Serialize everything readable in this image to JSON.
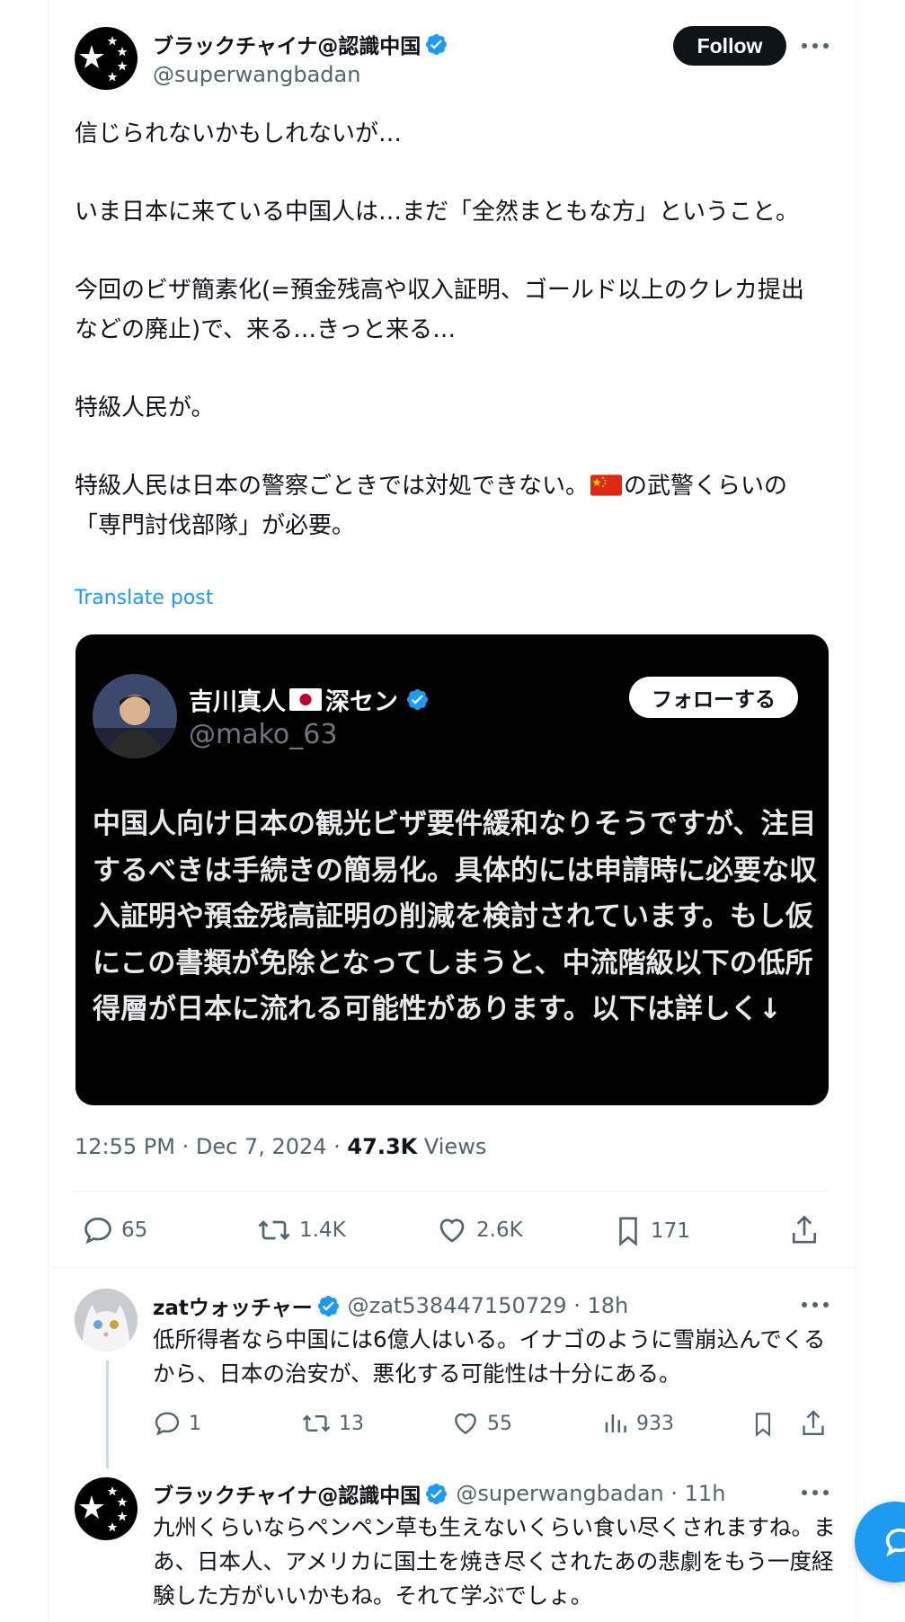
{
  "post": {
    "author_name": "ブラックチャイナ@認識中国",
    "author_handle": "@superwangbadan",
    "follow_label": "Follow",
    "text": {
      "p1": "信じられないかもしれないが…",
      "p2": "いま日本に来ている中国人は…まだ「全然まともな方」ということ。",
      "p3": "今回のビザ簡素化(=預金残高や収入証明、ゴールド以上のクレカ提出などの廃止)で、来る…きっと来る…",
      "p4": "特級人民が。",
      "p5a": "特級人民は日本の警察ごときでは対処できない。",
      "p5b": "の武警くらいの「専門討伐部隊」が必要。"
    },
    "translate_label": "Translate post",
    "timestamp": "12:55 PM · Dec 7, 2024 · ",
    "views_count": "47.3K",
    "views_label": " Views",
    "stats": {
      "replies": "65",
      "reposts": "1.4K",
      "likes": "2.6K",
      "bookmarks": "171"
    }
  },
  "embedded": {
    "name_a": "吉川真人",
    "name_b": "深セン",
    "handle": "@mako_63",
    "follow_label": "フォローする",
    "text": "中国人向け日本の観光ビザ要件緩和なりそうですが、注目するべきは手続きの簡易化。具体的には申請時に必要な収入証明や預金残高証明の削減を検討されています。もし仮にこの書類が免除となってしまうと、中流階級以下の低所得層が日本に流れる可能性があります。以下は詳しく↓"
  },
  "replies": [
    {
      "name": "zatウォッチャー",
      "handle_time": "@zat538447150729 · 18h",
      "text": "低所得者なら中国には6億人はいる。イナゴのように雪崩込んでくるから、日本の治安が、悪化する可能性は十分にある。",
      "replies": "1",
      "reposts": "13",
      "likes": "55",
      "views": "933"
    },
    {
      "name": "ブラックチャイナ@認識中国",
      "handle_time": "@superwangbadan · 11h",
      "text": "九州くらいならペンペン草も生えないくらい食い尽くされますね。まあ、日本人、アメリカに国土を焼き尽くされたあの悲劇をもう一度経験した方がいいかもね。それて学ぶでしょ。"
    }
  ],
  "colors": {
    "accent": "#1d9bf0",
    "text": "#0f1419",
    "secondary": "#536471"
  },
  "icons": [
    "verified-badge-icon",
    "more-icon",
    "reply-icon",
    "repost-icon",
    "like-icon",
    "bookmark-icon",
    "share-icon",
    "views-icon",
    "china-flag-icon",
    "japan-flag-icon",
    "compose-icon"
  ]
}
